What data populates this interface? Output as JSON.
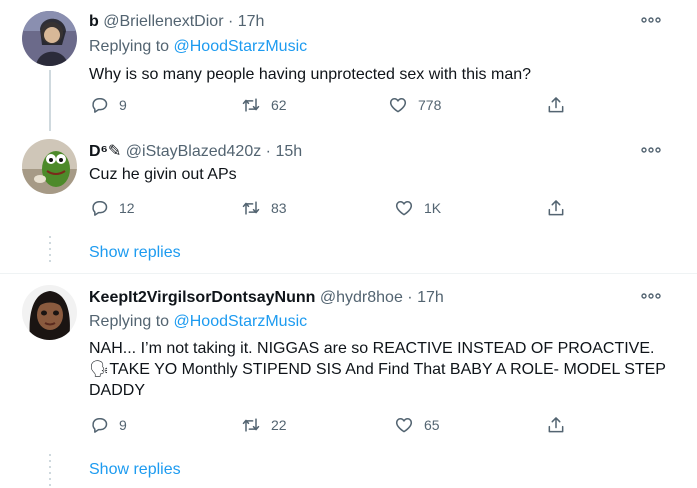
{
  "tweets": [
    {
      "name": "b",
      "handle": "@BriellenextDior",
      "sep": "·",
      "time": "17h",
      "replying_prefix": "Replying to",
      "replying_to": "@HoodStarzMusic",
      "text": "Why is so many people having unprotected sex with this man?",
      "replies": "9",
      "retweets": "62",
      "likes": "778"
    },
    {
      "name": "D⁶✎",
      "handle": "@iStayBlazed420z",
      "sep": "·",
      "time": "15h",
      "text": "Cuz he givin out APs",
      "replies": "12",
      "retweets": "83",
      "likes": "1K",
      "show_replies": "Show replies"
    },
    {
      "name": "KeepIt2VirgilsorDontsayNunn",
      "handle": "@hydr8hoe",
      "sep": "·",
      "time": "17h",
      "replying_prefix": "Replying to",
      "replying_to": "@HoodStarzMusic",
      "text_line1": "NAH... I’m not taking it. NIGGAS are so REACTIVE INSTEAD OF PROACTIVE.",
      "text_line2": "🗣TAKE YO Monthly STIPEND SIS And Find That BABY A ROLE- MODEL STEP",
      "text_line3": "DADDY",
      "replies": "9",
      "retweets": "22",
      "likes": "65",
      "show_replies": "Show replies"
    }
  ],
  "icons": {
    "reply": "reply-icon",
    "retweet": "retweet-icon",
    "like": "heart-icon",
    "share": "share-icon",
    "more": "more-icon"
  },
  "colors": {
    "link": "#1d9bf0",
    "secondary": "#536471",
    "thread_line": "#cfd9de"
  }
}
